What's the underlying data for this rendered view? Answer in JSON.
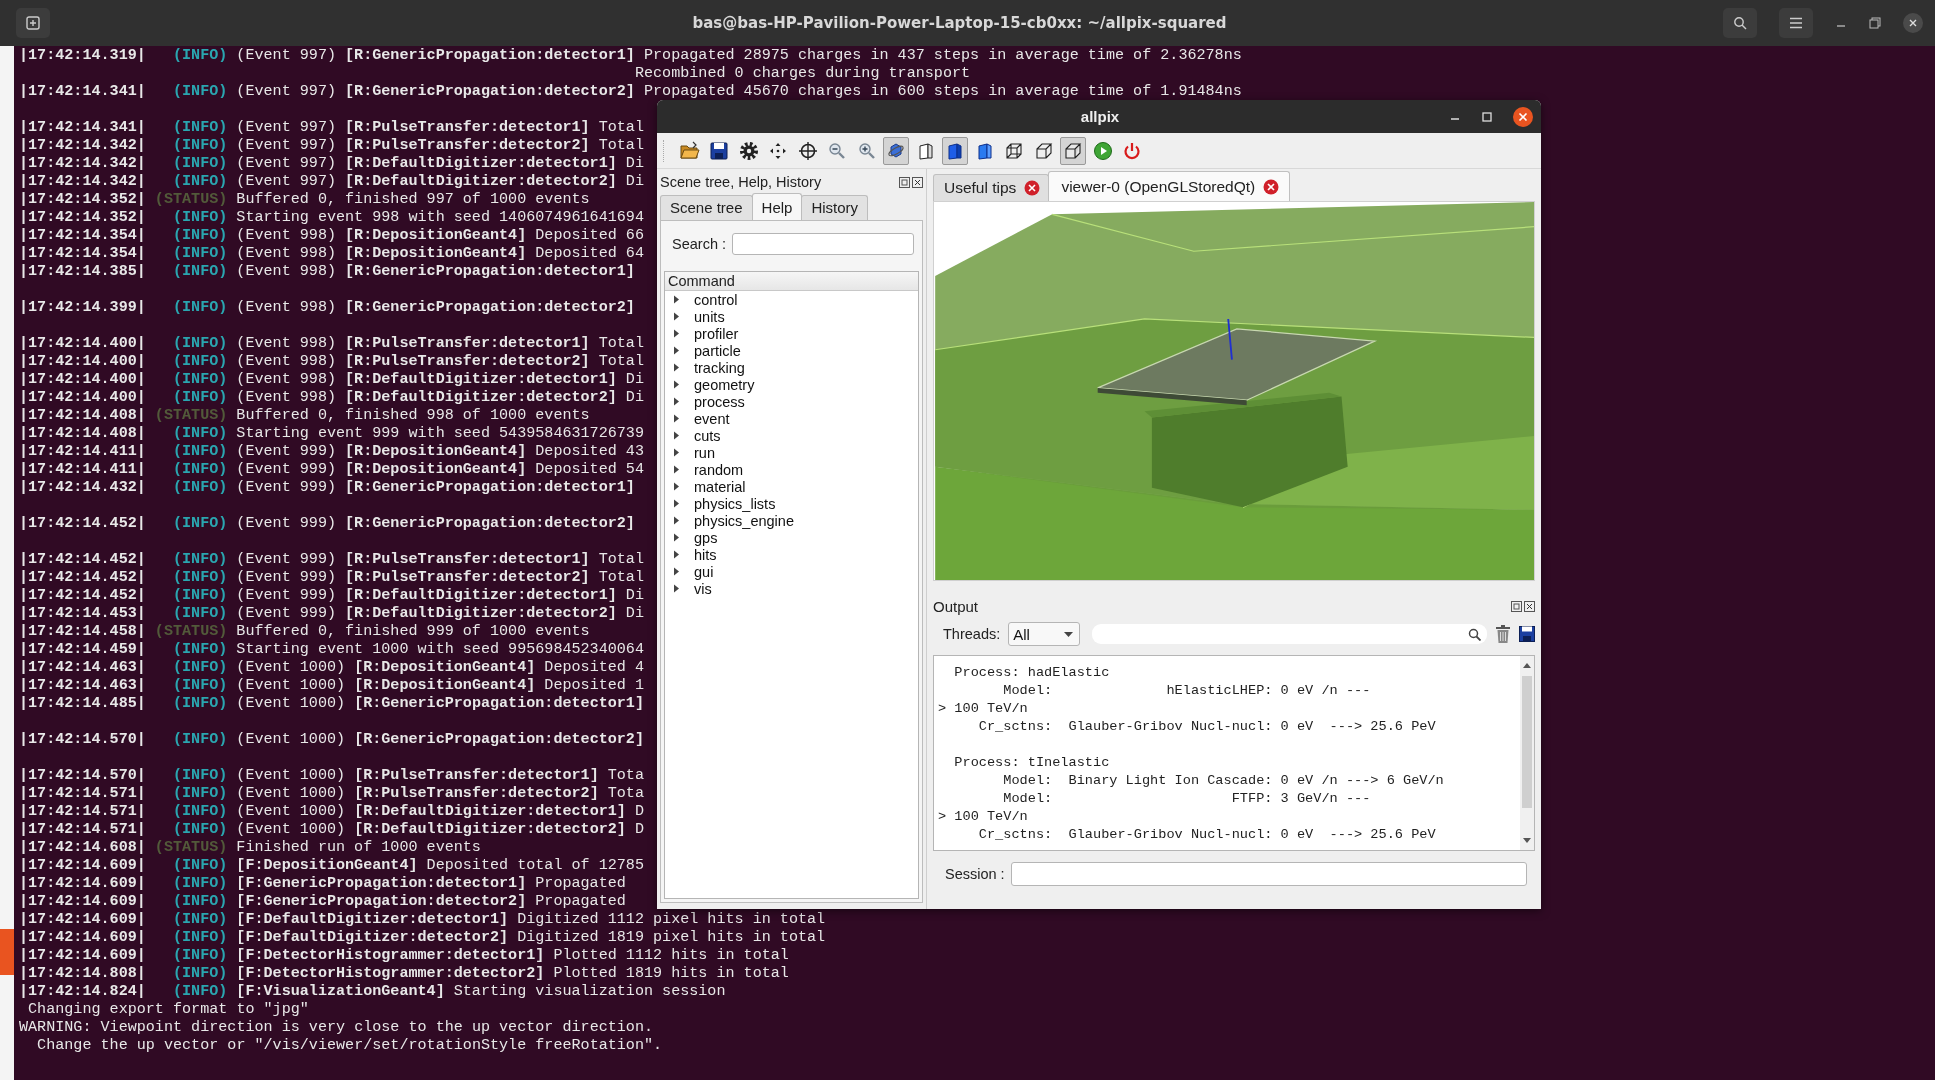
{
  "terminal": {
    "title": "bas@bas-HP-Pavilion-Power-Laptop-15-cb0xx: ~/allpix-squared",
    "rows": [
      {
        "kind": "log",
        "time": "|17:42:14.319|",
        "tag": "(INFO)",
        "color": "#2aa6b0",
        "msg": "(Event 997) **[R:GenericPropagation:detector1]** Propagated 28975 charges in 437 steps in average time of 2.36278ns"
      },
      {
        "kind": "continuation",
        "text": "Recombined 0 charges during transport"
      },
      {
        "kind": "log",
        "time": "|17:42:14.341|",
        "tag": "(INFO)",
        "color": "#2aa6b0",
        "msg": "(Event 997) **[R:GenericPropagation:detector2]** Propagated 45670 charges in 600 steps in average time of 1.91484ns"
      },
      {
        "kind": "blank"
      },
      {
        "kind": "log",
        "time": "|17:42:14.341|",
        "tag": "(INFO)",
        "color": "#2aa6b0",
        "msg": "(Event 997) **[R:PulseTransfer:detector1]** Total"
      },
      {
        "kind": "log",
        "time": "|17:42:14.342|",
        "tag": "(INFO)",
        "color": "#2aa6b0",
        "msg": "(Event 997) **[R:PulseTransfer:detector2]** Total"
      },
      {
        "kind": "log",
        "time": "|17:42:14.342|",
        "tag": "(INFO)",
        "color": "#2aa6b0",
        "msg": "(Event 997) **[R:DefaultDigitizer:detector1]** Di"
      },
      {
        "kind": "log",
        "time": "|17:42:14.342|",
        "tag": "(INFO)",
        "color": "#2aa6b0",
        "msg": "(Event 997) **[R:DefaultDigitizer:detector2]** Di"
      },
      {
        "kind": "log",
        "time": "|17:42:14.352|",
        "tag": "(STATUS)",
        "color": "#525a3a",
        "msg": "Buffered 0, finished 997 of 1000 events"
      },
      {
        "kind": "log",
        "time": "|17:42:14.352|",
        "tag": "(INFO)",
        "color": "#2aa6b0",
        "msg": "Starting event 998 with seed 1406074961641694"
      },
      {
        "kind": "log",
        "time": "|17:42:14.354|",
        "tag": "(INFO)",
        "color": "#2aa6b0",
        "msg": "(Event 998) **[R:DepositionGeant4]** Deposited 66"
      },
      {
        "kind": "log",
        "time": "|17:42:14.354|",
        "tag": "(INFO)",
        "color": "#2aa6b0",
        "msg": "(Event 998) **[R:DepositionGeant4]** Deposited 64"
      },
      {
        "kind": "log",
        "time": "|17:42:14.385|",
        "tag": "(INFO)",
        "color": "#2aa6b0",
        "msg": "(Event 998) **[R:GenericPropagation:detector1]**"
      },
      {
        "kind": "blank"
      },
      {
        "kind": "log",
        "time": "|17:42:14.399|",
        "tag": "(INFO)",
        "color": "#2aa6b0",
        "msg": "(Event 998) **[R:GenericPropagation:detector2]**"
      },
      {
        "kind": "blank"
      },
      {
        "kind": "log",
        "time": "|17:42:14.400|",
        "tag": "(INFO)",
        "color": "#2aa6b0",
        "msg": "(Event 998) **[R:PulseTransfer:detector1]** Total"
      },
      {
        "kind": "log",
        "time": "|17:42:14.400|",
        "tag": "(INFO)",
        "color": "#2aa6b0",
        "msg": "(Event 998) **[R:PulseTransfer:detector2]** Total"
      },
      {
        "kind": "log",
        "time": "|17:42:14.400|",
        "tag": "(INFO)",
        "color": "#2aa6b0",
        "msg": "(Event 998) **[R:DefaultDigitizer:detector1]** Di"
      },
      {
        "kind": "log",
        "time": "|17:42:14.400|",
        "tag": "(INFO)",
        "color": "#2aa6b0",
        "msg": "(Event 998) **[R:DefaultDigitizer:detector2]** Di"
      },
      {
        "kind": "log",
        "time": "|17:42:14.408|",
        "tag": "(STATUS)",
        "color": "#525a3a",
        "msg": "Buffered 0, finished 998 of 1000 events"
      },
      {
        "kind": "log",
        "time": "|17:42:14.408|",
        "tag": "(INFO)",
        "color": "#2aa6b0",
        "msg": "Starting event 999 with seed 5439584631726739"
      },
      {
        "kind": "log",
        "time": "|17:42:14.411|",
        "tag": "(INFO)",
        "color": "#2aa6b0",
        "msg": "(Event 999) **[R:DepositionGeant4]** Deposited 43"
      },
      {
        "kind": "log",
        "time": "|17:42:14.411|",
        "tag": "(INFO)",
        "color": "#2aa6b0",
        "msg": "(Event 999) **[R:DepositionGeant4]** Deposited 54"
      },
      {
        "kind": "log",
        "time": "|17:42:14.432|",
        "tag": "(INFO)",
        "color": "#2aa6b0",
        "msg": "(Event 999) **[R:GenericPropagation:detector1]**"
      },
      {
        "kind": "blank"
      },
      {
        "kind": "log",
        "time": "|17:42:14.452|",
        "tag": "(INFO)",
        "color": "#2aa6b0",
        "msg": "(Event 999) **[R:GenericPropagation:detector2]**"
      },
      {
        "kind": "blank"
      },
      {
        "kind": "log",
        "time": "|17:42:14.452|",
        "tag": "(INFO)",
        "color": "#2aa6b0",
        "msg": "(Event 999) **[R:PulseTransfer:detector1]** Total"
      },
      {
        "kind": "log",
        "time": "|17:42:14.452|",
        "tag": "(INFO)",
        "color": "#2aa6b0",
        "msg": "(Event 999) **[R:PulseTransfer:detector2]** Total"
      },
      {
        "kind": "log",
        "time": "|17:42:14.452|",
        "tag": "(INFO)",
        "color": "#2aa6b0",
        "msg": "(Event 999) **[R:DefaultDigitizer:detector1]** Di"
      },
      {
        "kind": "log",
        "time": "|17:42:14.453|",
        "tag": "(INFO)",
        "color": "#2aa6b0",
        "msg": "(Event 999) **[R:DefaultDigitizer:detector2]** Di"
      },
      {
        "kind": "log",
        "time": "|17:42:14.458|",
        "tag": "(STATUS)",
        "color": "#525a3a",
        "msg": "Buffered 0, finished 999 of 1000 events"
      },
      {
        "kind": "log",
        "time": "|17:42:14.459|",
        "tag": "(INFO)",
        "color": "#2aa6b0",
        "msg": "Starting event 1000 with seed 995698452340064"
      },
      {
        "kind": "log",
        "time": "|17:42:14.463|",
        "tag": "(INFO)",
        "color": "#2aa6b0",
        "msg": "(Event 1000) **[R:DepositionGeant4]** Deposited 4"
      },
      {
        "kind": "log",
        "time": "|17:42:14.463|",
        "tag": "(INFO)",
        "color": "#2aa6b0",
        "msg": "(Event 1000) **[R:DepositionGeant4]** Deposited 1"
      },
      {
        "kind": "log",
        "time": "|17:42:14.485|",
        "tag": "(INFO)",
        "color": "#2aa6b0",
        "msg": "(Event 1000) **[R:GenericPropagation:detector1]**"
      },
      {
        "kind": "blank"
      },
      {
        "kind": "log",
        "time": "|17:42:14.570|",
        "tag": "(INFO)",
        "color": "#2aa6b0",
        "msg": "(Event 1000) **[R:GenericPropagation:detector2]**"
      },
      {
        "kind": "blank"
      },
      {
        "kind": "log",
        "time": "|17:42:14.570|",
        "tag": "(INFO)",
        "color": "#2aa6b0",
        "msg": "(Event 1000) **[R:PulseTransfer:detector1]** Tota"
      },
      {
        "kind": "log",
        "time": "|17:42:14.571|",
        "tag": "(INFO)",
        "color": "#2aa6b0",
        "msg": "(Event 1000) **[R:PulseTransfer:detector2]** Tota"
      },
      {
        "kind": "log",
        "time": "|17:42:14.571|",
        "tag": "(INFO)",
        "color": "#2aa6b0",
        "msg": "(Event 1000) **[R:DefaultDigitizer:detector1]** D"
      },
      {
        "kind": "log",
        "time": "|17:42:14.571|",
        "tag": "(INFO)",
        "color": "#2aa6b0",
        "msg": "(Event 1000) **[R:DefaultDigitizer:detector2]** D"
      },
      {
        "kind": "log",
        "time": "|17:42:14.608|",
        "tag": "(STATUS)",
        "color": "#525a3a",
        "msg": "Finished run of 1000 events"
      },
      {
        "kind": "log",
        "time": "|17:42:14.609|",
        "tag": "(INFO)",
        "color": "#2aa6b0",
        "msg": "**[F:DepositionGeant4]** Deposited total of 12785"
      },
      {
        "kind": "log",
        "time": "|17:42:14.609|",
        "tag": "(INFO)",
        "color": "#2aa6b0",
        "msg": "**[F:GenericPropagation:detector1]** Propagated"
      },
      {
        "kind": "log",
        "time": "|17:42:14.609|",
        "tag": "(INFO)",
        "color": "#2aa6b0",
        "msg": "**[F:GenericPropagation:detector2]** Propagated"
      },
      {
        "kind": "log",
        "time": "|17:42:14.609|",
        "tag": "(INFO)",
        "color": "#2aa6b0",
        "msg": "**[F:DefaultDigitizer:detector1]** Digitized 1112 pixel hits in total"
      },
      {
        "kind": "log",
        "time": "|17:42:14.609|",
        "tag": "(INFO)",
        "color": "#2aa6b0",
        "msg": "**[F:DefaultDigitizer:detector2]** Digitized 1819 pixel hits in total"
      },
      {
        "kind": "log",
        "time": "|17:42:14.609|",
        "tag": "(INFO)",
        "color": "#2aa6b0",
        "msg": "**[F:DetectorHistogrammer:detector1]** Plotted 1112 hits in total"
      },
      {
        "kind": "log",
        "time": "|17:42:14.808|",
        "tag": "(INFO)",
        "color": "#2aa6b0",
        "msg": "**[F:DetectorHistogrammer:detector2]** Plotted 1819 hits in total"
      },
      {
        "kind": "log",
        "time": "|17:42:14.824|",
        "tag": "(INFO)",
        "color": "#2aa6b0",
        "msg": "**[F:VisualizationGeant4]** Starting visualization session"
      },
      {
        "kind": "plain",
        "text": " Changing export format to \"jpg\""
      },
      {
        "kind": "plain",
        "text": "WARNING: Viewpoint direction is very close to the up vector direction."
      },
      {
        "kind": "plain",
        "text": "  Change the up vector or \"/vis/viewer/set/rotationStyle freeRotation\"."
      }
    ]
  },
  "app_window": {
    "title": "allpix",
    "toolbar": [
      {
        "kind": "open",
        "selected": false
      },
      {
        "kind": "save",
        "selected": false
      },
      {
        "kind": "settings",
        "selected": false
      },
      {
        "kind": "move",
        "selected": false
      },
      {
        "kind": "target",
        "selected": false
      },
      {
        "kind": "zoomout",
        "selected": false
      },
      {
        "kind": "zoomin",
        "selected": false
      },
      {
        "kind": "rotate",
        "selected": true
      },
      {
        "kind": "surface",
        "selected": false
      },
      {
        "kind": "solid",
        "selected": true
      },
      {
        "kind": "solidlit",
        "selected": false
      },
      {
        "kind": "wireframe",
        "selected": false
      },
      {
        "kind": "hiddenline",
        "selected": false
      },
      {
        "kind": "hiddensurface",
        "selected": true
      },
      {
        "kind": "run",
        "selected": false
      },
      {
        "kind": "exit",
        "selected": false
      }
    ],
    "left_dock": {
      "title": "Scene tree, Help, History",
      "tabs": [
        {
          "label": "Scene tree",
          "selected": false
        },
        {
          "label": "Help",
          "selected": true
        },
        {
          "label": "History",
          "selected": false
        }
      ],
      "search_label": "Search :",
      "tree_header": "Command",
      "tree": [
        {
          "label": "control",
          "expanded": false
        },
        {
          "label": "units",
          "expanded": false
        },
        {
          "label": "profiler",
          "expanded": false
        },
        {
          "label": "particle",
          "expanded": false
        },
        {
          "label": "tracking",
          "expanded": false
        },
        {
          "label": "geometry",
          "expanded": false
        },
        {
          "label": "process",
          "expanded": false
        },
        {
          "label": "event",
          "expanded": false
        },
        {
          "label": "cuts",
          "expanded": false
        },
        {
          "label": "run",
          "expanded": false
        },
        {
          "label": "random",
          "expanded": false
        },
        {
          "label": "material",
          "expanded": false
        },
        {
          "label": "physics_lists",
          "expanded": false
        },
        {
          "label": "physics_engine",
          "expanded": false
        },
        {
          "label": "gps",
          "expanded": false
        },
        {
          "label": "hits",
          "expanded": false
        },
        {
          "label": "gui",
          "expanded": false
        },
        {
          "label": "vis",
          "expanded": false
        }
      ]
    },
    "viewer_tabs": [
      {
        "label": "Useful tips",
        "selected": false
      },
      {
        "label": "viewer-0 (OpenGLStoredQt)",
        "selected": true
      }
    ],
    "output": {
      "title": "Output",
      "threads_label": "Threads:",
      "threads_value": "All",
      "lines": [
        {
          "kind": "text",
          "text": "  Process: hadElastic"
        },
        {
          "kind": "text",
          "text": "        Model:              hElasticLHEP: 0 eV /n ---"
        },
        {
          "kind": "text",
          "text": "> 100 TeV/n"
        },
        {
          "kind": "text",
          "text": "     Cr_sctns:  Glauber-Gribov Nucl-nucl: 0 eV  ---> 25.6 PeV"
        },
        {
          "kind": "blank"
        },
        {
          "kind": "text",
          "text": "  Process: tInelastic"
        },
        {
          "kind": "text",
          "text": "        Model:  Binary Light Ion Cascade: 0 eV /n ---> 6 GeV/n"
        },
        {
          "kind": "text",
          "text": "        Model:                      FTFP: 3 GeV/n ---"
        },
        {
          "kind": "text",
          "text": "> 100 TeV/n"
        },
        {
          "kind": "text",
          "text": "     Cr_sctns:  Glauber-Gribov Nucl-nucl: 0 eV  ---> 25.6 PeV"
        }
      ],
      "session_label": "Session :"
    }
  }
}
